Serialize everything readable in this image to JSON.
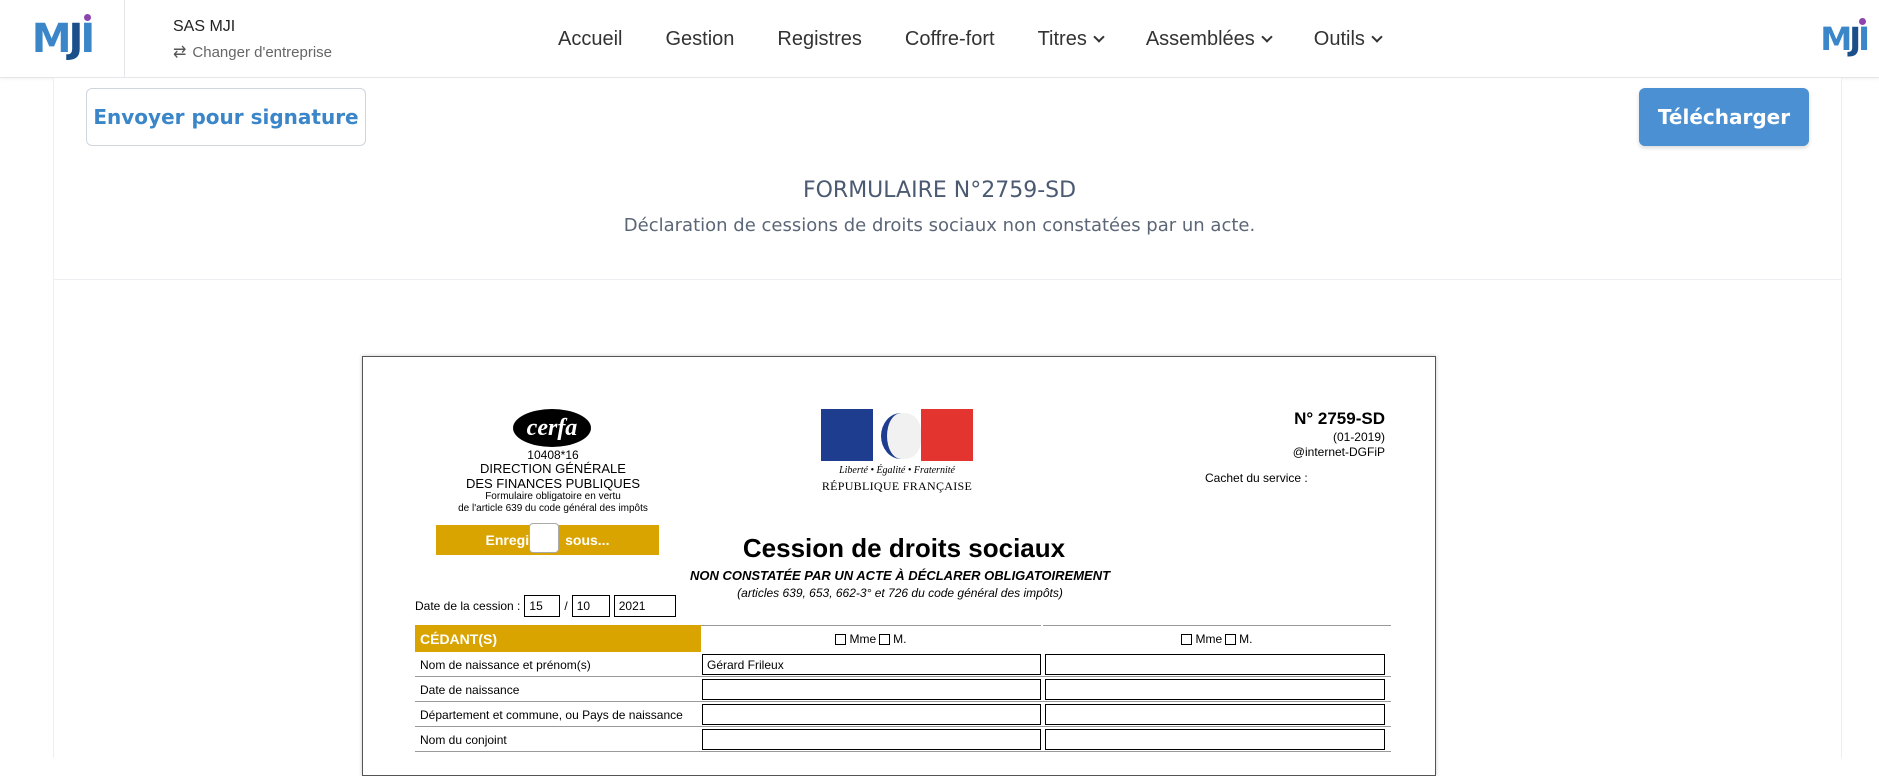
{
  "header": {
    "logo_text": "MJI",
    "company_name": "SAS MJI",
    "switch_label": "Changer d'entreprise",
    "nav": [
      {
        "label": "Accueil",
        "dropdown": false
      },
      {
        "label": "Gestion",
        "dropdown": false
      },
      {
        "label": "Registres",
        "dropdown": false
      },
      {
        "label": "Coffre-fort",
        "dropdown": false
      },
      {
        "label": "Titres",
        "dropdown": true
      },
      {
        "label": "Assemblées",
        "dropdown": true
      },
      {
        "label": "Outils",
        "dropdown": true
      }
    ]
  },
  "actions": {
    "send_label": "Envoyer pour signature",
    "download_label": "Télécharger"
  },
  "form": {
    "title": "FORMULAIRE N°2759-SD",
    "subtitle": "Déclaration de cessions de droits sociaux non constatées par un acte."
  },
  "document": {
    "cerfa": "cerfa",
    "cerfa_number": "10408*16",
    "dgfip_line1": "DIRECTION GÉNÉRALE",
    "dgfip_line2": "DES FINANCES PUBLIQUES",
    "oblig_line1": "Formulaire obligatoire en vertu",
    "oblig_line2": "de l'article 639 du code général des impôts",
    "save_label_left": "Enregi",
    "save_label_right": "sous...",
    "devise": "Liberté • Égalité • Fraternité",
    "republique": "RÉPUBLIQUE FRANÇAISE",
    "form_number": "N° 2759-SD",
    "version": "(01-2019)",
    "internet": "@internet-DGFiP",
    "cachet": "Cachet du service :",
    "title": "Cession de droits sociaux",
    "subtitle": "NON CONSTATÉE PAR UN ACTE À DÉCLARER OBLIGATOIREMENT",
    "articles": "(articles 639, 653, 662-3° et 726 du code général des impôts)",
    "date_label": "Date de la cession :",
    "date_day": "15",
    "date_month": "10",
    "date_year": "2021",
    "date_sep": "/",
    "cedant_header": "CÉDANT(S)",
    "civility_mme": "Mme",
    "civility_m": "M.",
    "rows": [
      {
        "label": "Nom de naissance et prénom(s)",
        "value1": "Gérard Frileux",
        "value2": ""
      },
      {
        "label": "Date de naissance",
        "value1": "",
        "value2": ""
      },
      {
        "label": "Département et commune, ou Pays de naissance",
        "value1": "",
        "value2": ""
      },
      {
        "label": "Nom du conjoint",
        "value1": "",
        "value2": ""
      }
    ]
  },
  "colors": {
    "brand_blue": "#3a86c8",
    "primary_button": "#4a90d2",
    "cerfa_gold": "#d9a400"
  }
}
